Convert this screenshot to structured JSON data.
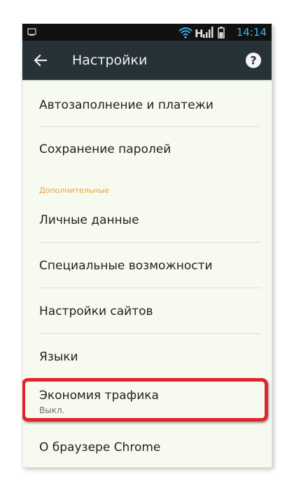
{
  "status_bar": {
    "time": "14:14",
    "time_color": "#3fb3e6",
    "icons": [
      "notification-icon",
      "wifi-icon",
      "signal-icon",
      "battery-icon"
    ]
  },
  "app_bar": {
    "title": "Настройки",
    "background": "#263238"
  },
  "settings": {
    "items": [
      {
        "label": "Автозаполнение и платежи"
      },
      {
        "label": "Сохранение паролей"
      }
    ],
    "section_header": "Дополнительные",
    "section_color": "#e8a33c",
    "advanced_items": [
      {
        "label": "Личные данные"
      },
      {
        "label": "Специальные возможности"
      },
      {
        "label": "Настройки сайтов"
      },
      {
        "label": "Языки"
      },
      {
        "label": "Экономия трафика",
        "subtitle": "Выкл.",
        "highlighted": true
      },
      {
        "label": "О браузере Chrome"
      }
    ]
  },
  "highlight_color": "#e2252c"
}
